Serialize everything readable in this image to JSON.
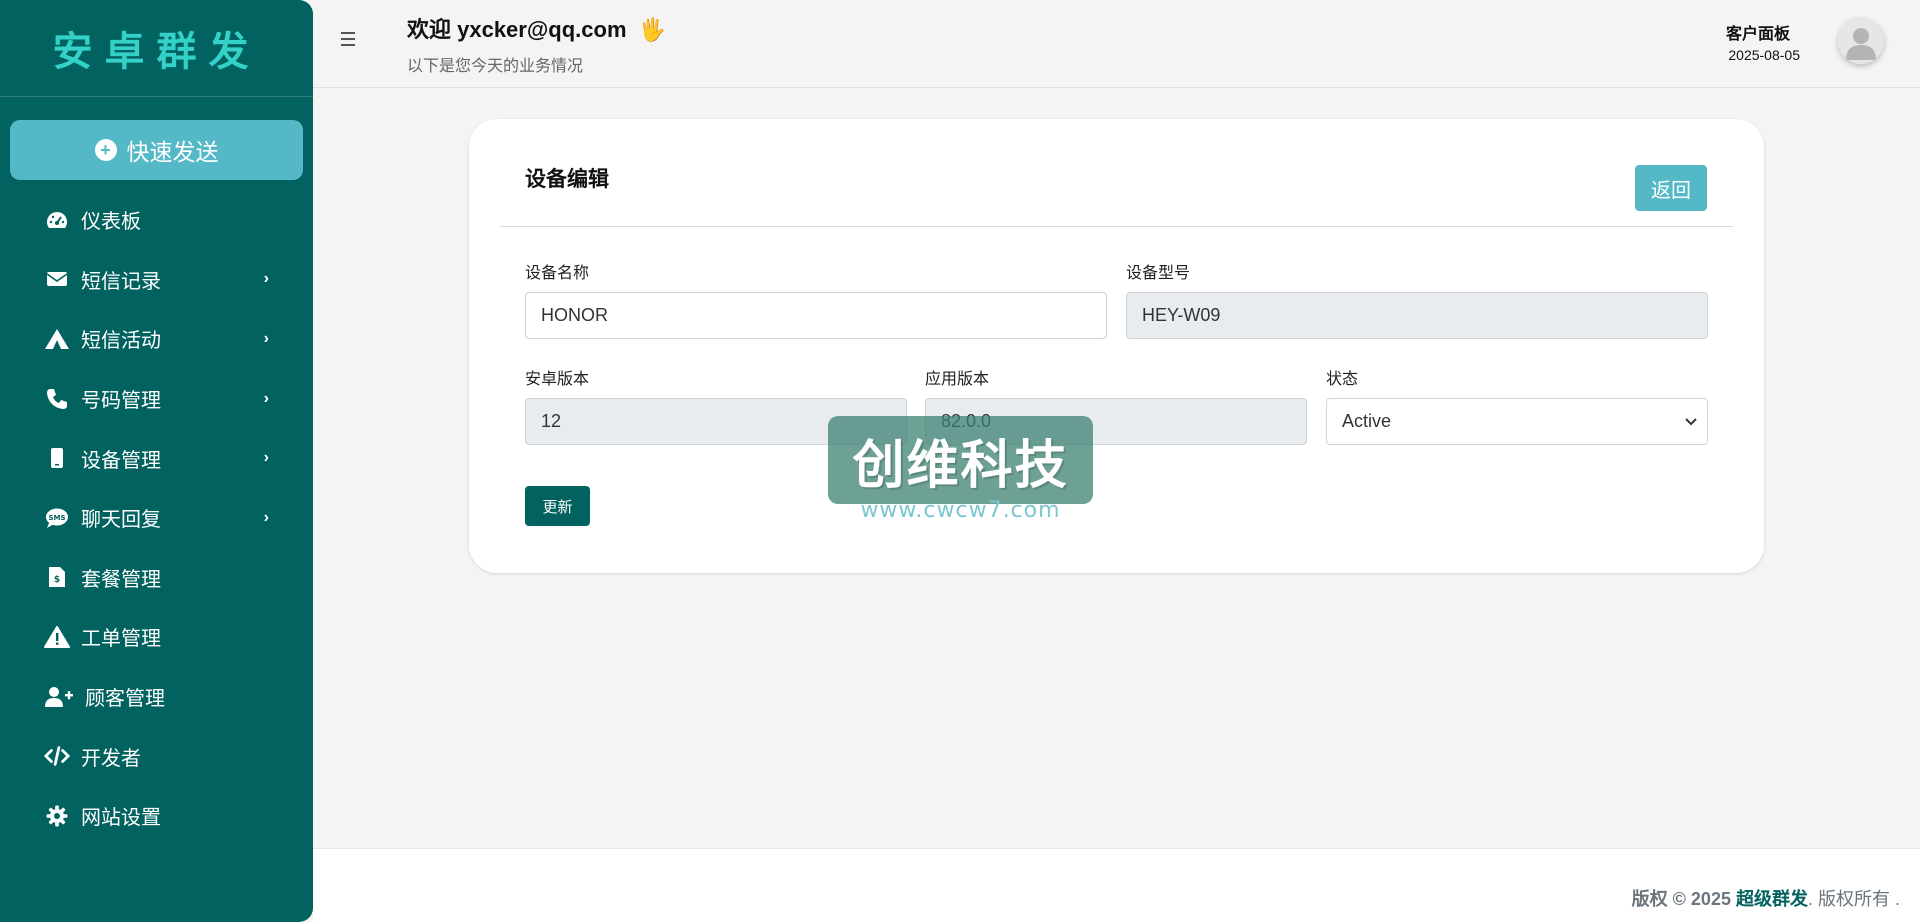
{
  "colors": {
    "sidebar_bg": "#02625f",
    "brand_text": "#33d1c8",
    "accent": "#54b8c6",
    "primary_button": "#02625f"
  },
  "sidebar": {
    "brand": "安卓群发",
    "quick_send": {
      "icon": "plus-circle-icon",
      "label": "快速发送"
    },
    "items": [
      {
        "icon": "dashboard-icon",
        "label": "仪表板",
        "has_submenu": false
      },
      {
        "icon": "envelope-icon",
        "label": "短信记录",
        "has_submenu": true
      },
      {
        "icon": "campground-icon",
        "label": "短信活动",
        "has_submenu": true
      },
      {
        "icon": "phone-icon",
        "label": "号码管理",
        "has_submenu": true
      },
      {
        "icon": "mobile-icon",
        "label": "设备管理",
        "has_submenu": true
      },
      {
        "icon": "sms-bubble-icon",
        "label": "聊天回复",
        "has_submenu": true
      },
      {
        "icon": "invoice-icon",
        "label": "套餐管理",
        "has_submenu": false
      },
      {
        "icon": "warning-icon",
        "label": "工单管理",
        "has_submenu": false
      },
      {
        "icon": "user-plus-icon",
        "label": "顾客管理",
        "has_submenu": false
      },
      {
        "icon": "code-icon",
        "label": "开发者",
        "has_submenu": false
      },
      {
        "icon": "gear-icon",
        "label": "网站设置",
        "has_submenu": false
      }
    ]
  },
  "header": {
    "welcome": "欢迎 yxcker@qq.com",
    "wave_icon": "🖐",
    "subtitle": "以下是您今天的业务情况",
    "panel_title": "客户面板",
    "date": "2025-08-05"
  },
  "form": {
    "title": "设备编辑",
    "back_label": "返回",
    "device_name": {
      "label": "设备名称",
      "value": "HONOR"
    },
    "device_model": {
      "label": "设备型号",
      "value": "HEY-W09"
    },
    "android_version": {
      "label": "安卓版本",
      "value": "12"
    },
    "app_version": {
      "label": "应用版本",
      "value": "82.0.0"
    },
    "status": {
      "label": "状态",
      "value": "Active"
    },
    "update_label": "更新"
  },
  "watermark": {
    "text": "创维科技",
    "url": "www.cwcw7.com"
  },
  "footer": {
    "copyright": "版权 © 2025",
    "brand": "超级群发",
    "rights": ". 版权所有 ."
  }
}
